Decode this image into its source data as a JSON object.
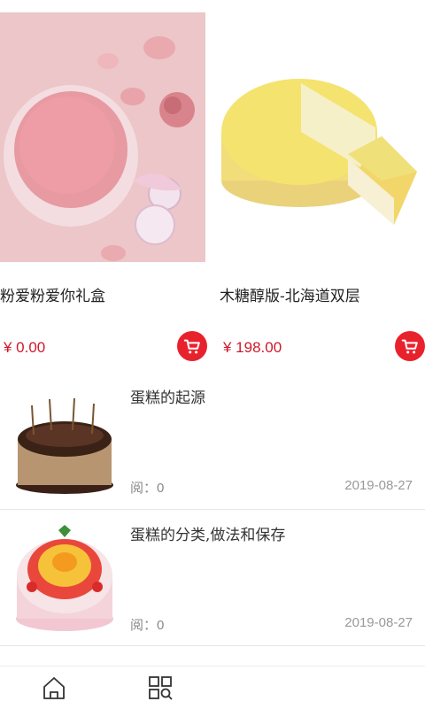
{
  "products": [
    {
      "name": "粉爱粉爱你礼盒",
      "price": "¥ 0.00",
      "image": "pink-cake-gift-box-photo"
    },
    {
      "name": "木糖醇版-北海道双层",
      "price": "¥ 198.00",
      "image": "yellow-hokkaido-cheesecake-photo"
    }
  ],
  "articles": [
    {
      "title": "蛋糕的起源",
      "reads": "阅：0",
      "date": "2019-08-27",
      "image": "chocolate-cake-photo"
    },
    {
      "title": "蛋糕的分类,做法和保存",
      "reads": "阅：0",
      "date": "2019-08-27",
      "image": "fruit-cream-cake-photo"
    }
  ],
  "nav": {
    "items": [
      {
        "icon": "home-icon"
      },
      {
        "icon": "category-search-icon"
      }
    ]
  },
  "colors": {
    "price": "#d0182b",
    "cart_button": "#e8222d"
  }
}
